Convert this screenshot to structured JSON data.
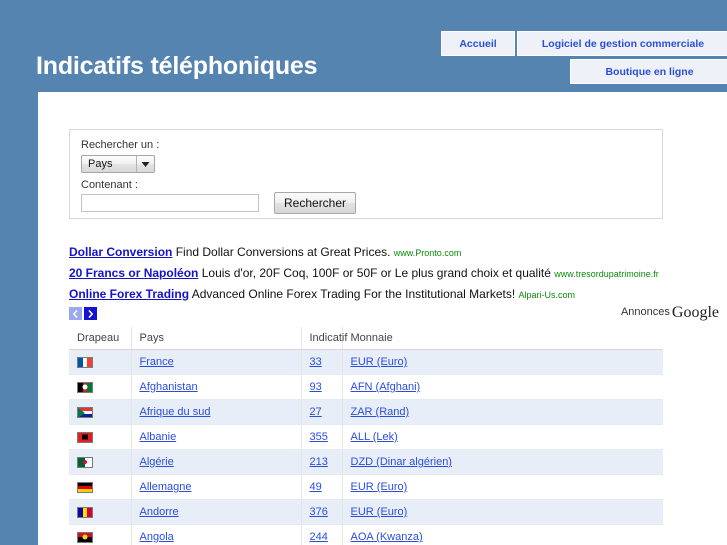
{
  "site": {
    "title": "Indicatifs téléphoniques",
    "header_color": "#5584b1"
  },
  "nav": {
    "items": [
      {
        "label": "Accueil"
      },
      {
        "label": "Logiciel de gestion commerciale"
      },
      {
        "label": "Boutique en ligne"
      }
    ]
  },
  "search": {
    "label_type": "Rechercher un :",
    "select_value": "Pays",
    "label_contains": "Contenant :",
    "input_value": "",
    "input_placeholder": "",
    "button_label": "Rechercher"
  },
  "ads": {
    "label": "Annonces",
    "brand": "Google",
    "prev_label": "‹",
    "next_label": "›",
    "items": [
      {
        "title": "Dollar Conversion",
        "desc": "Find Dollar Conversions at Great Prices.",
        "url": "www.Pronto.com"
      },
      {
        "title": "20 Francs or Napoléon",
        "desc": "Louis d'or, 20F Coq, 100F or 50F or Le plus grand choix et qualité",
        "url": "www.tresordupatrimoine.fr"
      },
      {
        "title": "Online Forex Trading",
        "desc": "Advanced Online Forex Trading For the Institutional Markets!",
        "url": "Alpari-Us.com"
      }
    ]
  },
  "table": {
    "headers": [
      "Drapeau",
      "Pays",
      "Indicatif",
      "Monnaie"
    ],
    "rows": [
      {
        "flag": "flag-france",
        "pays": "France",
        "indicatif": "33",
        "monnaie": "EUR (Euro)"
      },
      {
        "flag": "flag-afghanistan",
        "pays": "Afghanistan",
        "indicatif": "93",
        "monnaie": "AFN (Afghani)"
      },
      {
        "flag": "flag-afrique-du-sud",
        "pays": "Afrique du sud",
        "indicatif": "27",
        "monnaie": "ZAR (Rand)"
      },
      {
        "flag": "flag-albanie",
        "pays": "Albanie",
        "indicatif": "355",
        "monnaie": "ALL (Lek)"
      },
      {
        "flag": "flag-algerie",
        "pays": "Algérie",
        "indicatif": "213",
        "monnaie": "DZD (Dinar algérien)"
      },
      {
        "flag": "flag-allemagne",
        "pays": "Allemagne",
        "indicatif": "49",
        "monnaie": "EUR (Euro)"
      },
      {
        "flag": "flag-andorre",
        "pays": "Andorre",
        "indicatif": "376",
        "monnaie": "EUR (Euro)"
      },
      {
        "flag": "flag-angola",
        "pays": "Angola",
        "indicatif": "244",
        "monnaie": "AOA (Kwanza)"
      }
    ]
  }
}
